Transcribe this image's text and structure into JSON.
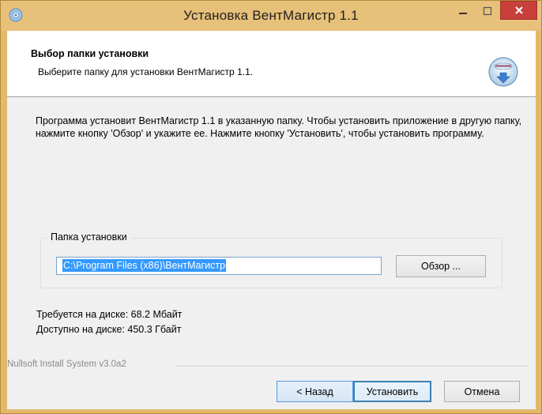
{
  "window": {
    "title": "Установка ВентМагистр 1.1"
  },
  "header": {
    "title": "Выбор папки установки",
    "subtitle": "Выберите папку для установки ВентМагистр 1.1."
  },
  "description": "Программа установит ВентМагистр 1.1 в указанную папку. Чтобы установить приложение в другую папку, нажмите кнопку 'Обзор' и укажите ее. Нажмите кнопку 'Установить', чтобы установить программу.",
  "destination": {
    "group_label": "Папка установки",
    "path_value": "C:\\Program Files (x86)\\ВентМагистр",
    "browse_label": "Обзор ..."
  },
  "space": {
    "required": "Требуется на диске: 68.2 Мбайт",
    "available": "Доступно на диске: 450.3 Гбайт"
  },
  "branding": "Nullsoft Install System v3.0a2",
  "buttons": {
    "back": "< Назад",
    "install": "Установить",
    "cancel": "Отмена"
  },
  "colors": {
    "titlebar": "#e7c079",
    "close_button": "#c7413a",
    "selection": "#3399ff"
  },
  "icons": {
    "title": "installer-disc-icon",
    "header": "installer-disc-icon",
    "minimize": "minimize-icon",
    "maximize": "maximize-icon",
    "close": "close-icon"
  }
}
